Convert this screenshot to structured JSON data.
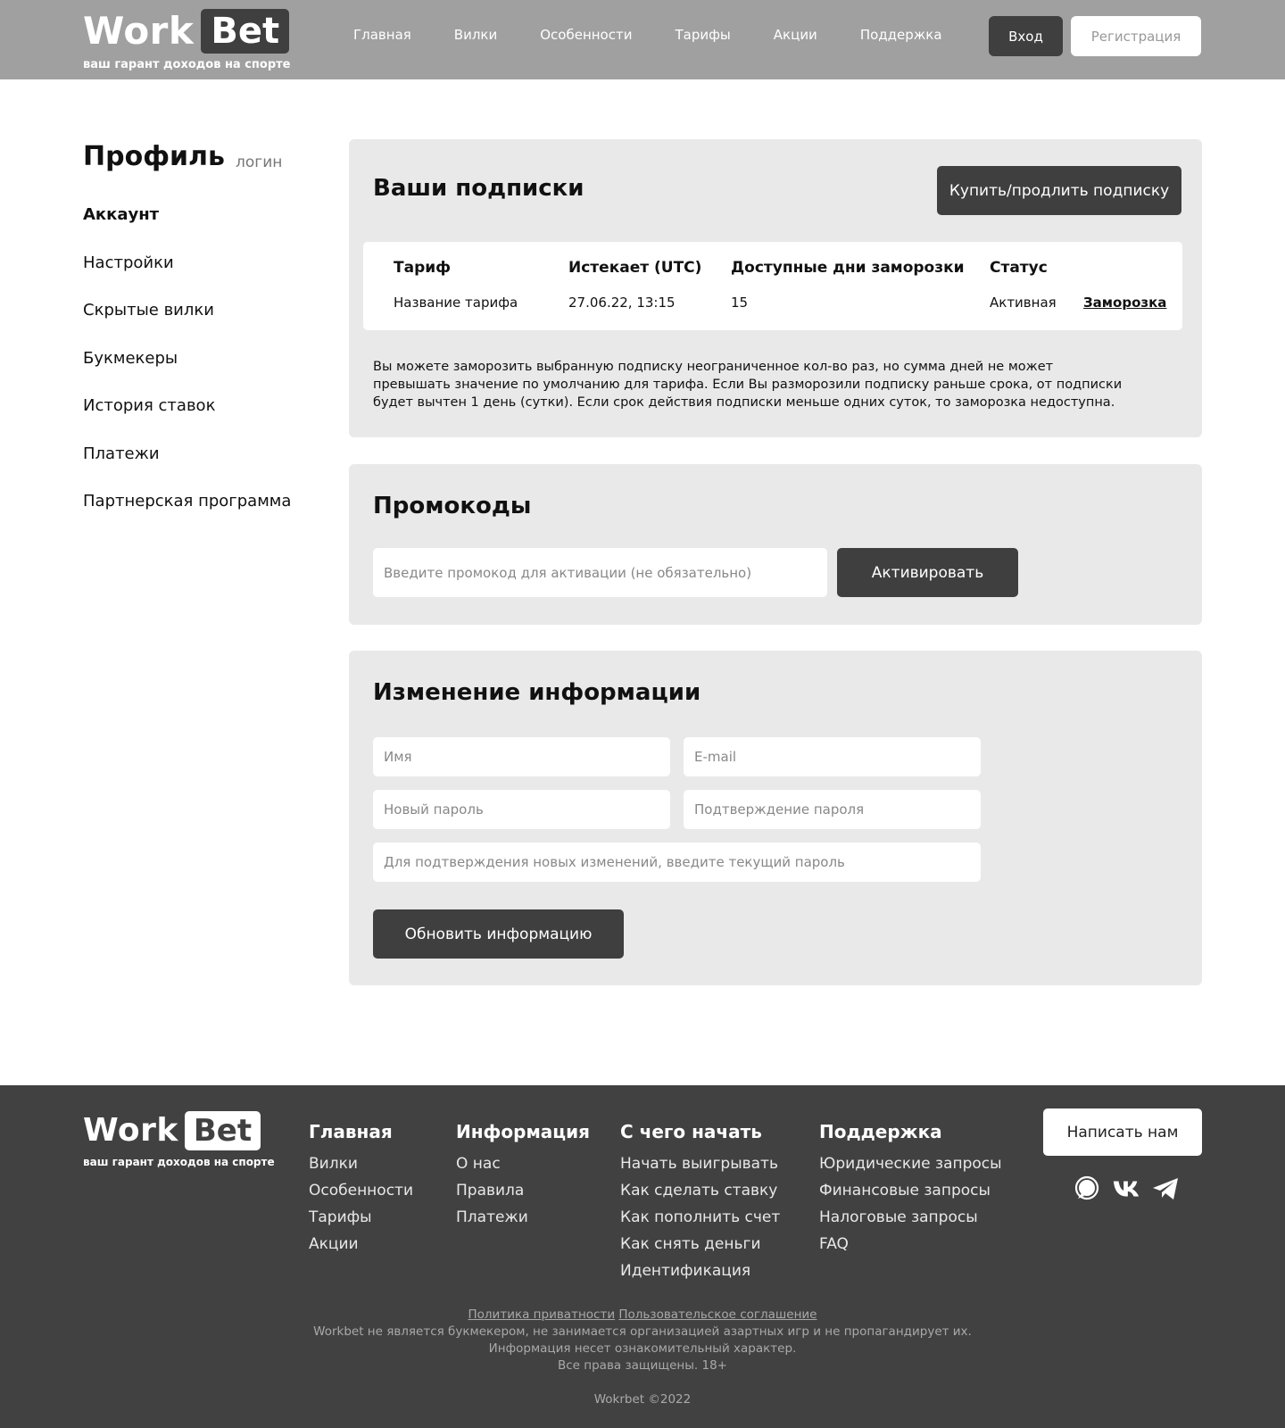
{
  "header": {
    "logo_work": "Work",
    "logo_bet": "Bet",
    "tagline": "ваш гарант доходов на спорте",
    "nav": [
      "Главная",
      "Вилки",
      "Особенности",
      "Тарифы",
      "Акции",
      "Поддержка"
    ],
    "login_label": "Вход",
    "register_label": "Регистрация"
  },
  "sidebar": {
    "title": "Профиль",
    "login": "логин",
    "items": [
      {
        "label": "Аккаунт",
        "active": true
      },
      {
        "label": "Настройки"
      },
      {
        "label": "Скрытые вилки"
      },
      {
        "label": "Букмекеры"
      },
      {
        "label": "История ставок"
      },
      {
        "label": "Платежи"
      },
      {
        "label": "Партнерская программа"
      }
    ]
  },
  "subscriptions": {
    "title": "Ваши подписки",
    "buy_label": "Купить/продлить подписку",
    "headers": {
      "plan": "Тариф",
      "expires": "Истекает (UTC)",
      "freeze_days": "Доступные дни заморозки",
      "status": "Статус"
    },
    "row": {
      "plan": "Название тарифа",
      "expires": "27.06.22, 13:15",
      "freeze_days": "15",
      "status": "Активная",
      "action": "Заморозка"
    },
    "note": "Вы можете заморозить выбранную подписку неограниченное кол-во раз, но сумма дней не может превышать значение по умолчанию для тарифа. Если Вы разморозили подписку раньше срока, от подписки будет вычтен 1 день (сутки). Если срок действия подписки меньше одних суток, то заморозка недоступна."
  },
  "promo": {
    "title": "Промокоды",
    "placeholder": "Введите промокод для активации (не обязательно)",
    "activate_label": "Активировать"
  },
  "info": {
    "title": "Изменение информации",
    "name_placeholder": "Имя",
    "email_placeholder": "E-mail",
    "new_password_placeholder": "Новый пароль",
    "confirm_password_placeholder": "Подтверждение пароля",
    "current_password_placeholder": "Для подтверждения новых изменений, введите текущий пароль",
    "update_label": "Обновить информацию"
  },
  "footer": {
    "logo_work": "Work",
    "logo_bet": "Bet",
    "tagline": "ваш гарант доходов на спорте",
    "columns": [
      {
        "title": "Главная",
        "items": [
          "Вилки",
          "Особенности",
          "Тарифы",
          "Акции"
        ]
      },
      {
        "title": "Информация",
        "items": [
          "О нас",
          "Правила",
          "Платежи"
        ]
      },
      {
        "title": "С чего начать",
        "items": [
          "Начать выигрывать",
          "Как сделать ставку",
          "Как пополнить счет",
          "Как снять деньги",
          "Идентификация"
        ]
      },
      {
        "title": "Поддержка",
        "items": [
          "Юридические запросы",
          "Финансовые запросы",
          "Налоговые запросы",
          "FAQ"
        ]
      }
    ],
    "write_label": "Написать нам",
    "socials": [
      "chat-icon",
      "vk-icon",
      "telegram-icon"
    ],
    "privacy_link": "Политика приватности",
    "agreement_link": "Пользовательское соглашение",
    "legal_1": "Workbet не является букмекером, не занимается организацией азартных игр и не пропагандирует их.",
    "legal_2": "Информация несет ознакомительный характер.",
    "legal_3": "Все права защищены. 18+",
    "copyright": "Wokrbet ©2022"
  }
}
